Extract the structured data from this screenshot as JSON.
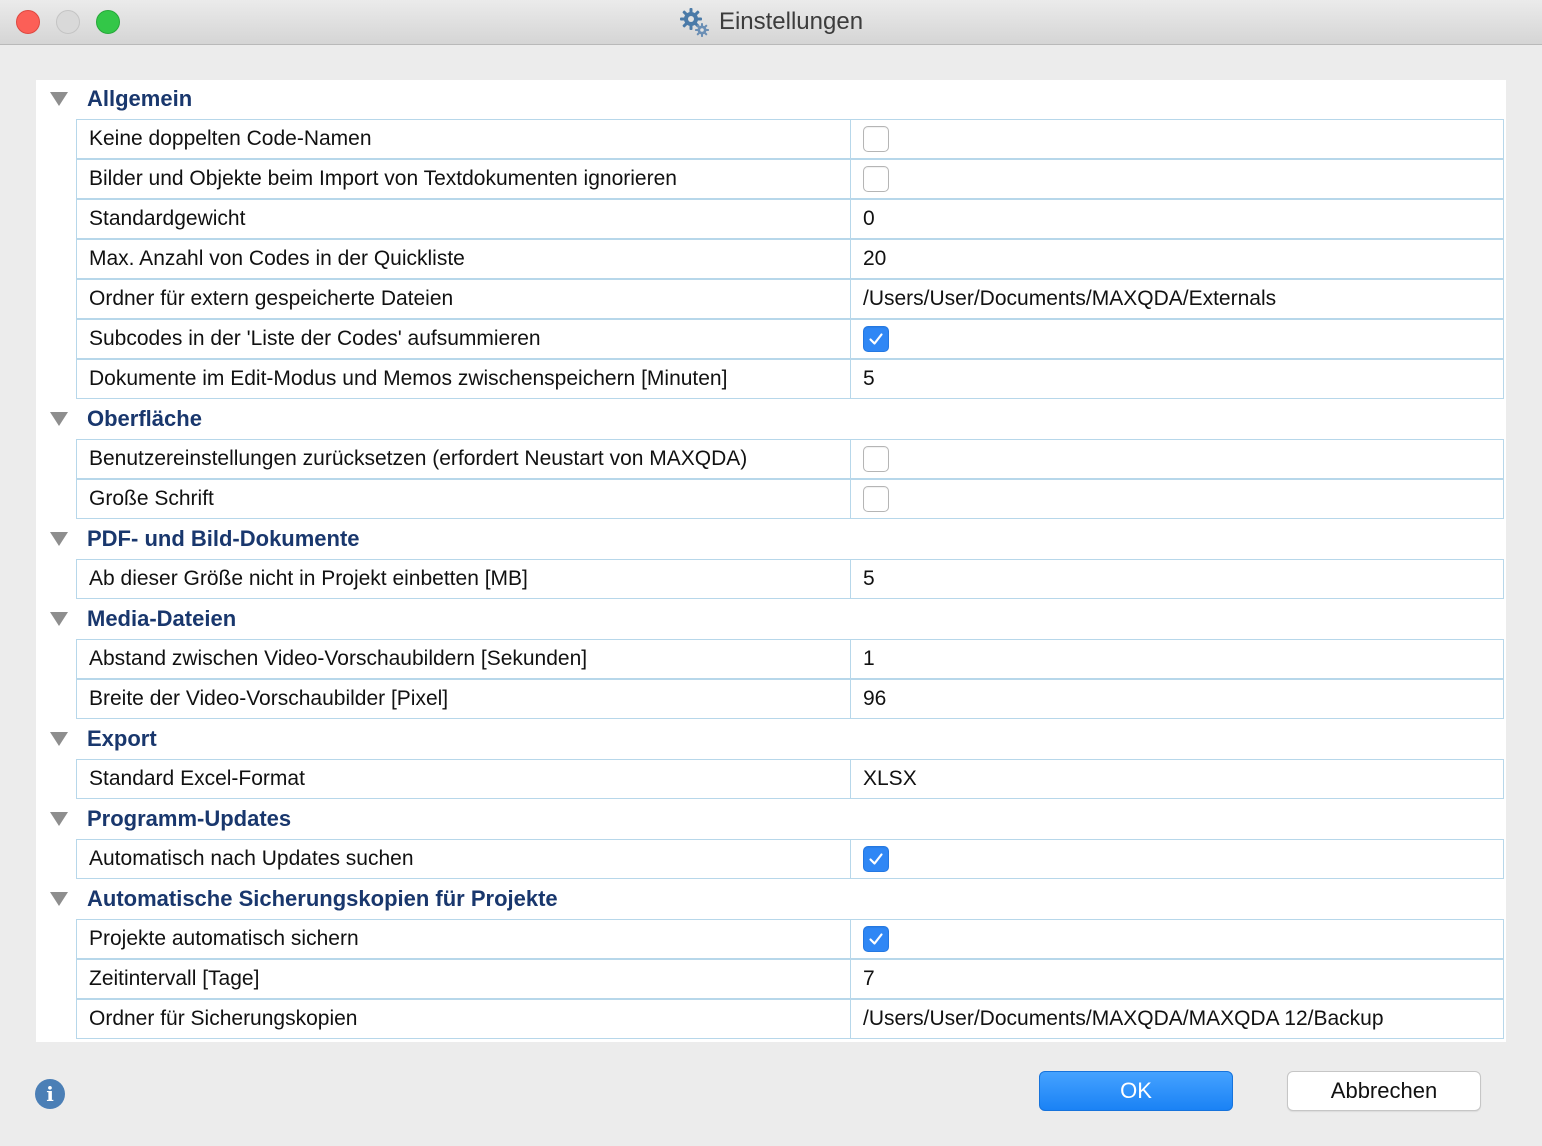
{
  "window": {
    "title": "Einstellungen"
  },
  "sections": [
    {
      "title": "Allgemein",
      "rows": [
        {
          "label": "Keine doppelten Code-Namen",
          "type": "checkbox",
          "checked": false
        },
        {
          "label": "Bilder und Objekte beim Import von Textdokumenten ignorieren",
          "type": "checkbox",
          "checked": false
        },
        {
          "label": "Standardgewicht",
          "type": "text",
          "value": "0"
        },
        {
          "label": "Max. Anzahl von Codes in der Quickliste",
          "type": "text",
          "value": "20"
        },
        {
          "label": "Ordner für extern gespeicherte Dateien",
          "type": "text",
          "value": "/Users/User/Documents/MAXQDA/Externals"
        },
        {
          "label": "Subcodes in der 'Liste der Codes' aufsummieren",
          "type": "checkbox",
          "checked": true
        },
        {
          "label": "Dokumente im Edit-Modus und Memos zwischenspeichern [Minuten]",
          "type": "text",
          "value": "5"
        }
      ]
    },
    {
      "title": "Oberfläche",
      "rows": [
        {
          "label": "Benutzereinstellungen zurücksetzen (erfordert Neustart von MAXQDA)",
          "type": "checkbox",
          "checked": false
        },
        {
          "label": "Große Schrift",
          "type": "checkbox",
          "checked": false
        }
      ]
    },
    {
      "title": "PDF- und Bild-Dokumente",
      "rows": [
        {
          "label": "Ab dieser Größe nicht in Projekt einbetten [MB]",
          "type": "text",
          "value": "5"
        }
      ]
    },
    {
      "title": "Media-Dateien",
      "rows": [
        {
          "label": "Abstand zwischen Video-Vorschaubildern [Sekunden]",
          "type": "text",
          "value": "1"
        },
        {
          "label": "Breite der Video-Vorschaubilder [Pixel]",
          "type": "text",
          "value": "96"
        }
      ]
    },
    {
      "title": "Export",
      "rows": [
        {
          "label": "Standard Excel-Format",
          "type": "text",
          "value": "XLSX"
        }
      ]
    },
    {
      "title": "Programm-Updates",
      "rows": [
        {
          "label": "Automatisch nach Updates suchen",
          "type": "checkbox",
          "checked": true
        }
      ]
    },
    {
      "title": "Automatische Sicherungskopien für Projekte",
      "rows": [
        {
          "label": "Projekte automatisch sichern",
          "type": "checkbox",
          "checked": true
        },
        {
          "label": "Zeitintervall [Tage]",
          "type": "text",
          "value": "7"
        },
        {
          "label": "Ordner für Sicherungskopien",
          "type": "text",
          "value": "/Users/User/Documents/MAXQDA/MAXQDA 12/Backup"
        }
      ]
    }
  ],
  "buttons": {
    "ok": "OK",
    "cancel": "Abbrechen"
  },
  "colors": {
    "section_title": "#19376d",
    "accent": "#2f87f5",
    "grid": "#b7d7ea"
  }
}
